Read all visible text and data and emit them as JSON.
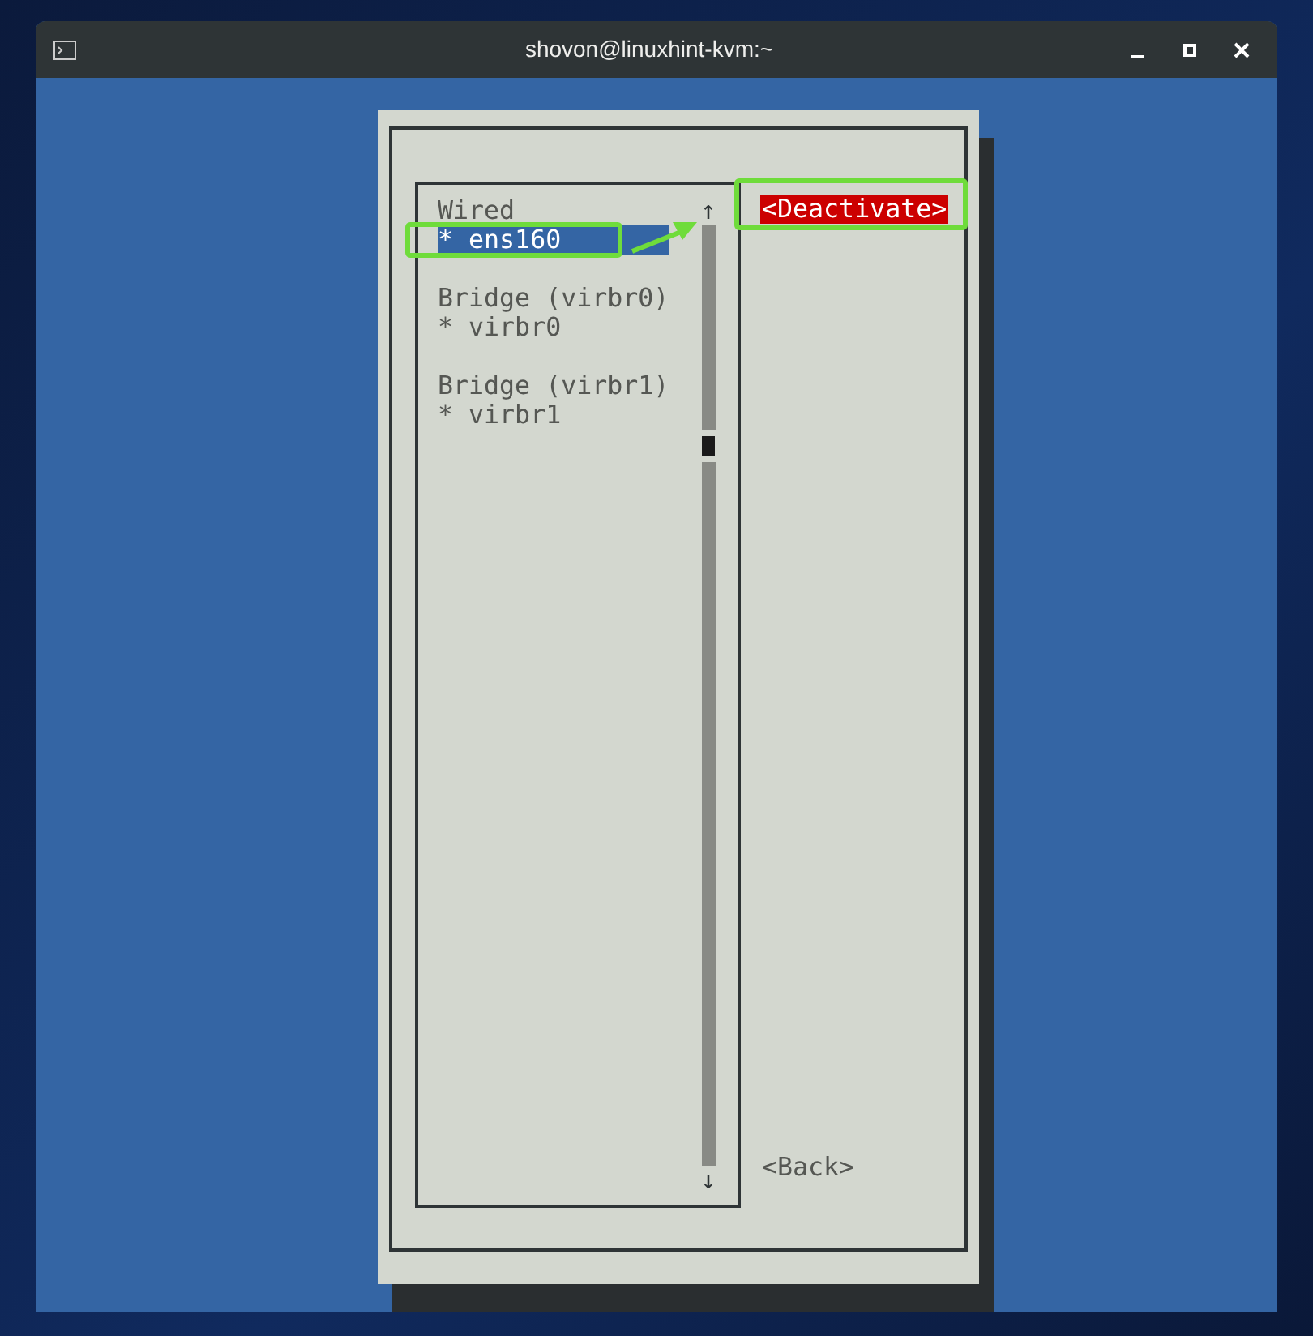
{
  "window": {
    "title": "shovon@linuxhint-kvm:~"
  },
  "connections": [
    {
      "heading": "Wired",
      "items": [
        {
          "label": "* ens160",
          "selected": true
        }
      ]
    },
    {
      "heading": "Bridge (virbr0)",
      "items": [
        {
          "label": "* virbr0",
          "selected": false
        }
      ]
    },
    {
      "heading": "Bridge (virbr1)",
      "items": [
        {
          "label": "* virbr1",
          "selected": false
        }
      ]
    }
  ],
  "scroll_arrows": {
    "up": "↑",
    "down": "↓"
  },
  "actions": [
    {
      "label": "<Deactivate>",
      "selected": true
    },
    {
      "label": "<Back>",
      "selected": false
    }
  ]
}
